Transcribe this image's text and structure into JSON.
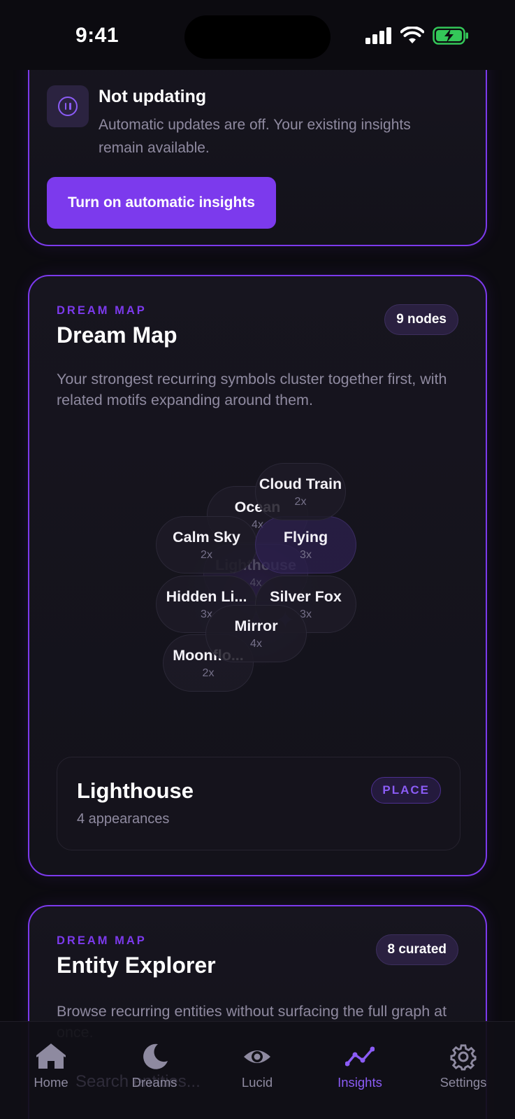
{
  "status_bar": {
    "time": "9:41"
  },
  "update_card": {
    "title": "Not updating",
    "description": "Automatic updates are off. Your existing insights remain available.",
    "button_label": "Turn on automatic insights",
    "icon": "pause-icon"
  },
  "dream_map_card": {
    "eyebrow": "DREAM MAP",
    "title": "Dream Map",
    "badge": "9 nodes",
    "description": "Your strongest recurring symbols cluster together first, with related motifs expanding around them.",
    "nodes": [
      {
        "label": "Ocean",
        "count": "4x"
      },
      {
        "label": "Lighthouse",
        "count": "4x"
      },
      {
        "label": "Calm Sky",
        "count": "2x"
      },
      {
        "label": "Hidden Li...",
        "count": "3x"
      },
      {
        "label": "Moonflo...",
        "count": "2x"
      },
      {
        "label": "Silver Fox",
        "count": "3x"
      },
      {
        "label": "Flying",
        "count": "3x"
      },
      {
        "label": "Mirror",
        "count": "4x"
      },
      {
        "label": "Cloud Train",
        "count": "2x"
      }
    ],
    "selected": {
      "title": "Lighthouse",
      "subtitle": "4 appearances",
      "tag": "PLACE"
    }
  },
  "entity_card": {
    "eyebrow": "DREAM MAP",
    "title": "Entity Explorer",
    "badge": "8 curated",
    "description": "Browse recurring entities without surfacing the full graph at once.",
    "search_placeholder": "Search entities..."
  },
  "tabbar": {
    "tabs": [
      {
        "label": "Home",
        "icon": "home-icon"
      },
      {
        "label": "Dreams",
        "icon": "moon-icon"
      },
      {
        "label": "Lucid",
        "icon": "eye-icon"
      },
      {
        "label": "Insights",
        "icon": "chart-line-icon",
        "active": true
      },
      {
        "label": "Settings",
        "icon": "gear-icon"
      }
    ]
  },
  "colors": {
    "accent": "#7c3aed",
    "background": "#0c0b10",
    "card": "#16141d"
  }
}
